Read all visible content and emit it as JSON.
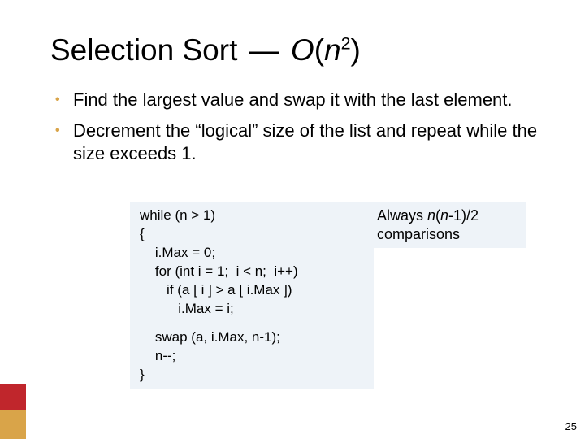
{
  "title": {
    "name": "Selection Sort",
    "sep": "—",
    "bigo_o": "O",
    "bigo_open": "(",
    "bigo_n": "n",
    "bigo_sup": "2",
    "bigo_close": ")"
  },
  "bullets": [
    "Find the largest value and swap it with the last element.",
    "Decrement the “logical” size of the list and repeat while the size exceeds 1."
  ],
  "code": {
    "lines": [
      "while (n > 1)",
      "{",
      "    i.Max = 0;",
      "    for (int i = 1;  i < n;  i++)",
      "       if (a [ i ] > a [ i.Max ])",
      "          i.Max = i;",
      "",
      "    swap (a, i.Max, n-1);",
      "    n--;",
      "}"
    ]
  },
  "note": {
    "prefix": "Always ",
    "expr_n1": "n",
    "expr_open": "(",
    "expr_n2": "n",
    "expr_minus1": "-1)/2",
    "suffix": "comparisons"
  },
  "page_number": "25"
}
